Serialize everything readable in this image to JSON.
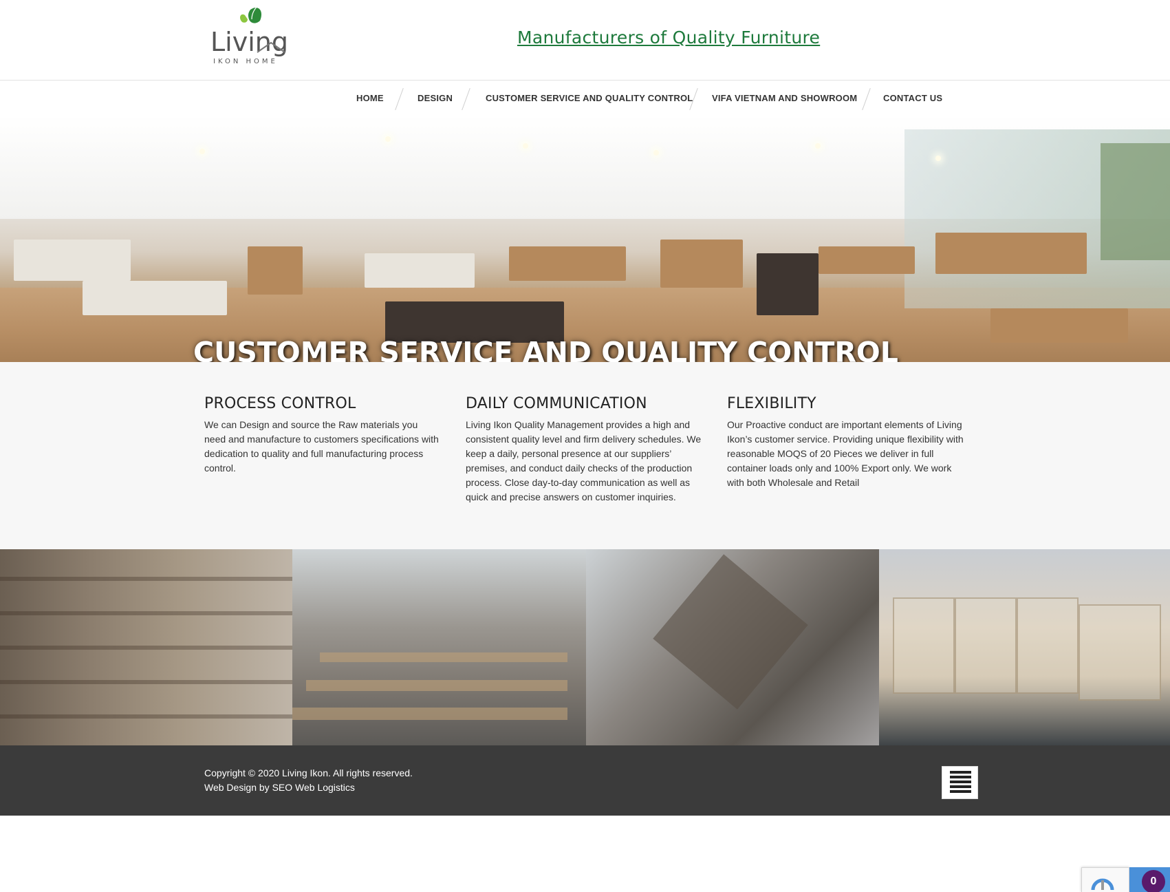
{
  "header": {
    "logo_main": "Living",
    "logo_sub": "IKON HOME",
    "tagline": "Manufacturers of Quality Furniture"
  },
  "nav": {
    "items": [
      {
        "label": "HOME"
      },
      {
        "label": "DESIGN"
      },
      {
        "label": "CUSTOMER SERVICE AND QUALITY CONTROL"
      },
      {
        "label": "VIFA VIETNAM AND SHOWROOM"
      },
      {
        "label": "CONTACT US"
      }
    ]
  },
  "hero": {
    "title": "CUSTOMER SERVICE AND QUALITY CONTROL"
  },
  "features": [
    {
      "heading": "PROCESS CONTROL",
      "text": "We can Design and source the Raw materials you need and manufacture to customers specifications with dedication to quality and full manufacturing process control."
    },
    {
      "heading": "DAILY COMMUNICATION",
      "text": "Living Ikon Quality Management provides a high and consistent quality level and firm delivery schedules. We keep a daily, personal presence at our suppliers’ premises, and conduct daily checks of the production process. Close day-to-day communication as well as quick and precise answers on customer inquiries."
    },
    {
      "heading": "FLEXIBILITY",
      "text": "Our Proactive conduct are important elements of Living Ikon’s customer service. Providing unique flexibility with reasonable MOQS of 20 Pieces we deliver in full container loads only and 100% Export only. We work with both Wholesale and Retail"
    }
  ],
  "footer": {
    "copyright": "Copyright © 2020 Living Ikon. All rights reserved.",
    "credit": "Web Design by SEO Web Logistics"
  },
  "widgets": {
    "badge_count": "0"
  },
  "colors": {
    "tagline": "#1e7a3c",
    "footer_bg": "#3b3b3b",
    "features_bg": "#f7f7f7",
    "badge": "#5a1a6b"
  },
  "icons": [
    "leaf-logo-icon",
    "hamburger-menu-icon",
    "recaptcha-icon"
  ]
}
